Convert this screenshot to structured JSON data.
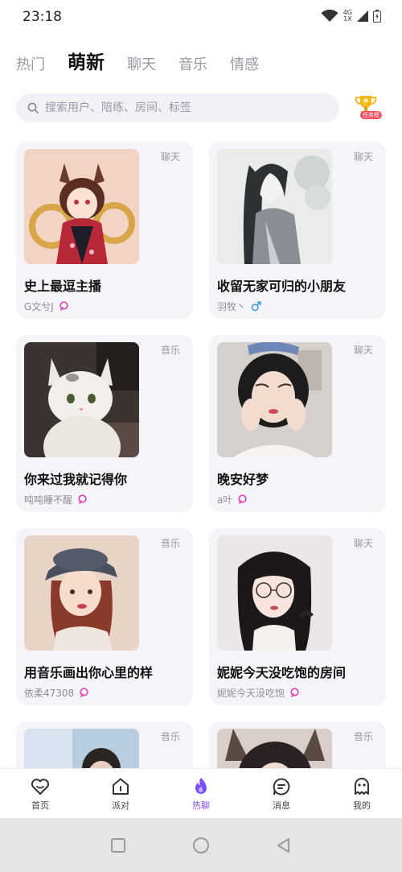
{
  "status": {
    "time": "23:18",
    "network_top": "4G",
    "network_bottom": "1X"
  },
  "tabs": [
    {
      "label": "热门",
      "active": false
    },
    {
      "label": "萌新",
      "active": true
    },
    {
      "label": "聊天",
      "active": false
    },
    {
      "label": "音乐",
      "active": false
    },
    {
      "label": "情感",
      "active": false
    }
  ],
  "search": {
    "placeholder": "搜索用户、陪练、房间、标签"
  },
  "ranking": {
    "badge": "任务榜"
  },
  "rooms": [
    {
      "tag": "聊天",
      "title": "史上最逗主播",
      "host": "G文兮J",
      "host_icon": "voice-wave-icon"
    },
    {
      "tag": "聊天",
      "title": "收留无家可归的小朋友",
      "host": "羽牧丶",
      "host_icon": "male-icon"
    },
    {
      "tag": "音乐",
      "title": "你来过我就记得你",
      "host": "吨吨睡不醒",
      "host_icon": "voice-wave-icon"
    },
    {
      "tag": "聊天",
      "title": "晚安好梦",
      "host": "a叶",
      "host_icon": "voice-wave-icon"
    },
    {
      "tag": "音乐",
      "title": "用音乐画出你心里的样",
      "host": "依柔47308",
      "host_icon": "voice-wave-icon"
    },
    {
      "tag": "聊天",
      "title": "妮妮今天没吃饱的房间",
      "host": "妮妮今天没吃饱",
      "host_icon": "voice-wave-icon"
    },
    {
      "tag": "音乐",
      "title": "",
      "host": "",
      "host_icon": ""
    },
    {
      "tag": "音乐",
      "title": "",
      "host": "",
      "host_icon": ""
    }
  ],
  "bottom_nav": [
    {
      "label": "首页",
      "icon": "heart-home-icon",
      "active": false
    },
    {
      "label": "派对",
      "icon": "house-icon",
      "active": false
    },
    {
      "label": "热聊",
      "icon": "flame-icon",
      "active": true
    },
    {
      "label": "消息",
      "icon": "chat-bubble-icon",
      "active": false
    },
    {
      "label": "我的",
      "icon": "ghost-profile-icon",
      "active": false
    }
  ],
  "colors": {
    "accent": "#7b4dff",
    "male": "#3aa0e6",
    "voice": "#e040b0"
  }
}
